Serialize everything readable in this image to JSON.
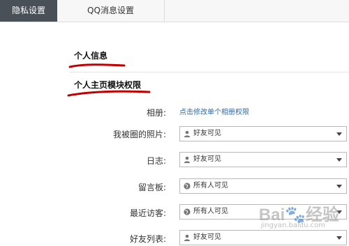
{
  "tabs": [
    {
      "label": "隐私设置",
      "active": true
    },
    {
      "label": "QQ消息设置",
      "active": false
    }
  ],
  "sections": {
    "personal_info": "个人信息",
    "home_module_permissions": "个人主页模块权限"
  },
  "rows": [
    {
      "label": "相册:",
      "link": "点击修改单个相册权限"
    },
    {
      "label": "我被圈的照片:",
      "value": "好友可见",
      "icon": "person-icon"
    },
    {
      "label": "日志:",
      "value": "好友可见",
      "icon": "person-icon"
    },
    {
      "label": "留言板:",
      "value": "所有人可见",
      "icon": "globe-icon"
    },
    {
      "label": "最近访客:",
      "value": "所有人可见",
      "icon": "globe-icon"
    },
    {
      "label": "好友列表:",
      "value": "好友可见",
      "icon": "person-icon"
    }
  ],
  "watermark": {
    "text": "Bai🐾经验",
    "url": "jingyan.baidu.com"
  },
  "colors": {
    "tab_active_bg": "#4a5058",
    "link": "#2b6bb1",
    "underline": "#c00000"
  }
}
